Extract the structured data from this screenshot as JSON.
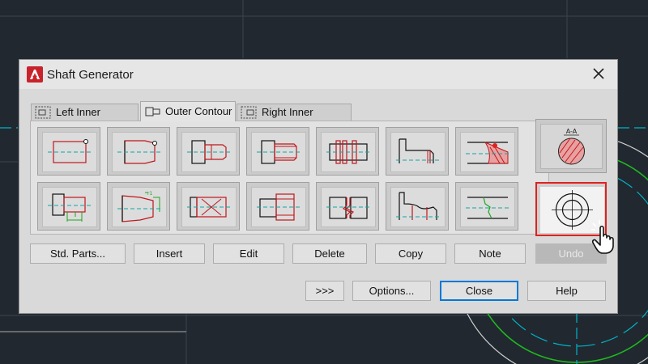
{
  "dialog": {
    "title": "Shaft Generator",
    "close_icon": "close-icon",
    "app_icon": "autocad-logo-icon"
  },
  "tabs": [
    {
      "label": "Left Inner Contour",
      "icon": "left-inner-contour-icon",
      "active": false
    },
    {
      "label": "Outer Contour",
      "icon": "outer-contour-icon",
      "active": true
    },
    {
      "label": "Right Inner Contour",
      "icon": "right-inner-contour-icon",
      "active": false
    }
  ],
  "shapes_row1": [
    "cylinder",
    "cone",
    "shaft-end",
    "thread",
    "spline",
    "profile",
    "section-hatch"
  ],
  "shapes_row2": [
    "cylinder-dimensioned",
    "cone-dimensioned",
    "cross-section",
    "keyway",
    "break",
    "wave",
    "tangent-transition"
  ],
  "side_panel": {
    "section_view_label": "A-A",
    "section_view_icon": "section-view-icon",
    "center_mark_icon": "center-mark-icon"
  },
  "action_buttons": {
    "std_parts": "Std. Parts...",
    "insert": "Insert",
    "edit": "Edit",
    "delete": "Delete",
    "copy": "Copy",
    "note": "Note",
    "undo": "Undo"
  },
  "footer_buttons": {
    "more": ">>>",
    "options": "Options...",
    "close": "Close",
    "help": "Help"
  },
  "colors": {
    "accent_red": "#e0211d",
    "cad_background": "#212830",
    "cad_green": "#1fb81f",
    "cad_cyan": "#00b4c8"
  },
  "cursor_icon": "hand-pointer-icon"
}
